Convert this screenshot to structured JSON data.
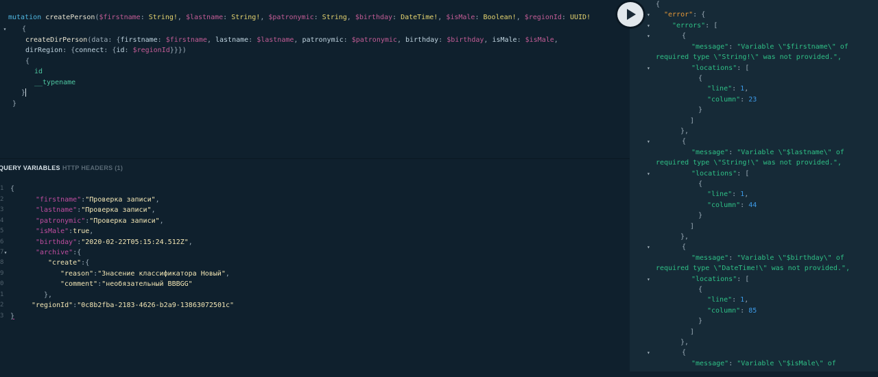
{
  "query": {
    "line1": {
      "mutation": "mutation",
      "name": "createPerson",
      "params": [
        {
          "var": "$firstname",
          "type": "String!"
        },
        {
          "var": "$lastname",
          "type": "String!"
        },
        {
          "var": "$patronymic",
          "type": "String"
        },
        {
          "var": "$birthday",
          "type": "DateTime!"
        },
        {
          "var": "$isMale",
          "type": "Boolean!"
        },
        {
          "var": "$regionId",
          "type": "UUID!"
        }
      ]
    },
    "open_brace": "{",
    "call": "createDirPerson",
    "args": [
      {
        "field": "firstname",
        "var": "$firstname"
      },
      {
        "field": "lastname",
        "var": "$lastname"
      },
      {
        "field": "patronymic",
        "var": "$patronymic"
      },
      {
        "field": "birthday",
        "var": "$birthday"
      },
      {
        "field": "isMale",
        "var": "$isMale"
      }
    ],
    "region_field": "dirRegion",
    "connect": "connect",
    "id_field": "id",
    "region_var": "$regionId",
    "selections": [
      "id",
      "__typename"
    ]
  },
  "tabs": {
    "query_variables": "QUERY VARIABLES",
    "http_headers": "HTTP HEADERS (1)"
  },
  "variables": {
    "line_numbers": [
      "1",
      "2",
      "3",
      "4",
      "5",
      "6",
      "7",
      "8",
      "9",
      "0",
      "1",
      "2",
      "3"
    ],
    "firstname_key": "\"firstname\"",
    "firstname_val": "\"Проверка записи\"",
    "lastname_key": "\"lastname\"",
    "lastname_val": "\"Проверка записи\"",
    "patronymic_key": "\"patronymic\"",
    "patronymic_val": "\"Проверка записи\"",
    "isMale_key": "\"isMale\"",
    "isMale_val": "true",
    "birthday_key": "\"birthday\"",
    "birthday_val": "\"2020-02-22T05:15:24.512Z\"",
    "archive_key": "\"archive\"",
    "create_key": "\"create\"",
    "reason_key": "\"reason\"",
    "reason_val": "\"Знасение классификатора Новый\"",
    "comment_key": "\"comment\"",
    "comment_val": "\"необязательный BBBGG\"",
    "regionId_key": "\"regionId\"",
    "regionId_val": "\"0c8b2fba-2183-4626-b2a9-13863072501c\""
  },
  "result": {
    "error_key": "\"error\"",
    "errors_key": "\"errors\"",
    "message_key": "\"message\"",
    "locations_key": "\"locations\"",
    "line_key": "\"line\"",
    "column_key": "\"column\"",
    "items": [
      {
        "msg1": "\"Variable \\\"$firstname\\\" of",
        "msg2": "required type \\\"String!\\\" was not provided.\",",
        "line": "1",
        "column": "23"
      },
      {
        "msg1": "\"Variable \\\"$lastname\\\" of",
        "msg2": "required type \\\"String!\\\" was not provided.\",",
        "line": "1",
        "column": "44"
      },
      {
        "msg1": "\"Variable \\\"$birthday\\\" of",
        "msg2": "required type \\\"DateTime!\\\" was not provided.\",",
        "line": "1",
        "column": "85"
      },
      {
        "msg1": "\"Variable \\\"$isMale\\\" of",
        "msg2": "",
        "line": "",
        "column": ""
      }
    ]
  },
  "icons": {
    "run": "play-icon",
    "fold": "fold-arrow-icon"
  },
  "colors": {
    "editor_bg": "#0f202d",
    "result_bg": "#162a37",
    "run_button": "#e2e8ec"
  }
}
